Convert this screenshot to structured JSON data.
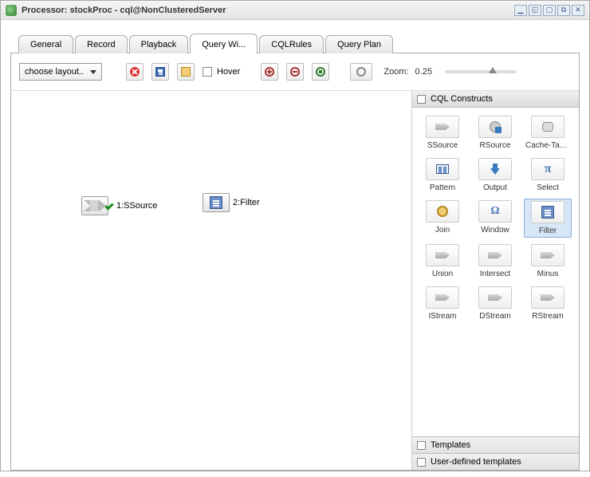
{
  "title": "Processor: stockProc - cql@NonClusteredServer",
  "tabs": [
    {
      "label": "General"
    },
    {
      "label": "Record"
    },
    {
      "label": "Playback"
    },
    {
      "label": "Query Wi...",
      "active": true
    },
    {
      "label": "CQLRules"
    },
    {
      "label": "Query Plan"
    }
  ],
  "toolbar": {
    "layout_select": "choose layout..",
    "hover_label": "Hover",
    "zoom_label": "Zoom:",
    "zoom_value": "0.25"
  },
  "canvas": {
    "nodes": [
      {
        "label": "1:SSource"
      },
      {
        "label": "2:Filter"
      }
    ]
  },
  "palette": {
    "title": "CQL Constructs",
    "constructs": [
      {
        "label": "SSource",
        "glyph": "arrow"
      },
      {
        "label": "RSource",
        "glyph": "cache"
      },
      {
        "label": "Cache-Table",
        "glyph": "db"
      },
      {
        "label": "Pattern",
        "glyph": "pattern"
      },
      {
        "label": "Output",
        "glyph": "output"
      },
      {
        "label": "Select",
        "glyph": "pi"
      },
      {
        "label": "Join",
        "glyph": "circle"
      },
      {
        "label": "Window",
        "glyph": "omega"
      },
      {
        "label": "Filter",
        "glyph": "filter",
        "selected": true
      },
      {
        "label": "Union",
        "glyph": "arrow"
      },
      {
        "label": "Intersect",
        "glyph": "arrow"
      },
      {
        "label": "Minus",
        "glyph": "arrow"
      },
      {
        "label": "IStream",
        "glyph": "arrow"
      },
      {
        "label": "DStream",
        "glyph": "arrow"
      },
      {
        "label": "RStream",
        "glyph": "arrow"
      }
    ],
    "sections": [
      {
        "label": "Templates"
      },
      {
        "label": "User-defined templates"
      }
    ]
  }
}
